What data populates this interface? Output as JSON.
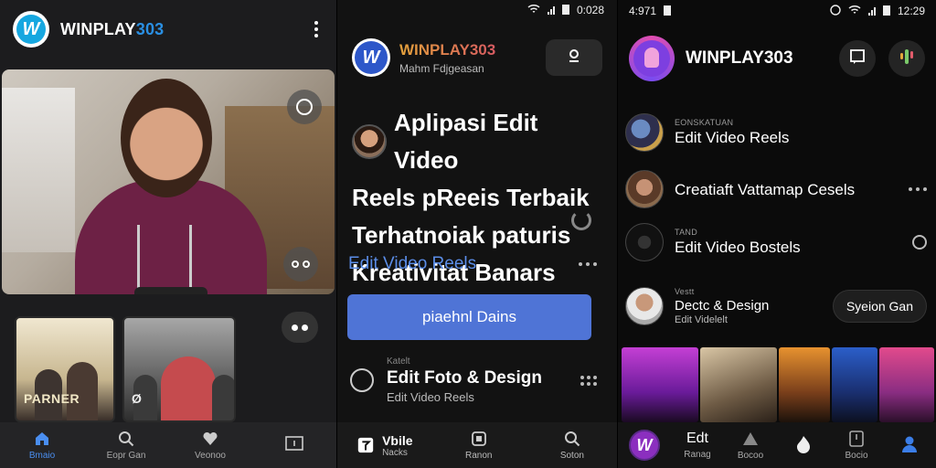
{
  "panel1": {
    "brand_prefix": "WINPLAY",
    "brand_number": "303",
    "logo_letter": "W",
    "thumb_text": "PARNER",
    "thumb_b_text": "Ø",
    "nav": [
      {
        "label": "Bmaio",
        "icon": "home-icon",
        "active": true
      },
      {
        "label": "Eopr Gan",
        "icon": "search-icon"
      },
      {
        "label": "Veonoo",
        "icon": "heart-icon"
      },
      {
        "label": "",
        "icon": "square-icon"
      }
    ]
  },
  "panel2": {
    "status_time": "0:028",
    "brand": "WINPLAY303",
    "subtitle": "Mahm Fdjgeasan",
    "logo_letter": "W",
    "title_lines": [
      "Aplipasi Edit Video",
      "Reels pReeis Terbaik",
      "Terhatnoiak paturis",
      "Kreativitat Banars"
    ],
    "link": "Edit Video Reels",
    "cta": "piaehnl Dains",
    "item": {
      "caption": "Katelt",
      "title": "Edit Foto & Design",
      "subtitle": "Edit Video Reels"
    },
    "nav": [
      {
        "label": "",
        "big": "Vbile",
        "small": "Nacks"
      },
      {
        "label": "Ranon"
      },
      {
        "label": "Soton"
      }
    ]
  },
  "panel3": {
    "status_left": "4:971",
    "status_time": "12:29",
    "brand": "WINPLAY303",
    "items": [
      {
        "caption": "EONSKATUAN",
        "title": "Edit Video Reels",
        "subtitle": ""
      },
      {
        "caption": "",
        "title": "Creatiaft Vattamap Cesels",
        "subtitle": ""
      },
      {
        "caption": "TAND",
        "title": "Edit Video Bostels",
        "subtitle": ""
      },
      {
        "caption": "Vestt",
        "title": "Dectc & Design",
        "subtitle": "Edit Videlelt"
      }
    ],
    "pill": "Syeion  Gan",
    "nav": [
      {
        "label": "",
        "logo": "W"
      },
      {
        "label": "Ranag",
        "big": "Edt"
      },
      {
        "label": "Bocoo"
      },
      {
        "label": ""
      },
      {
        "label": "Bocio"
      },
      {
        "label": ""
      }
    ]
  },
  "colors": {
    "accent_blue": "#4f74d6",
    "brand_blue": "#2a8fe3",
    "active_nav": "#4a8ef0"
  }
}
